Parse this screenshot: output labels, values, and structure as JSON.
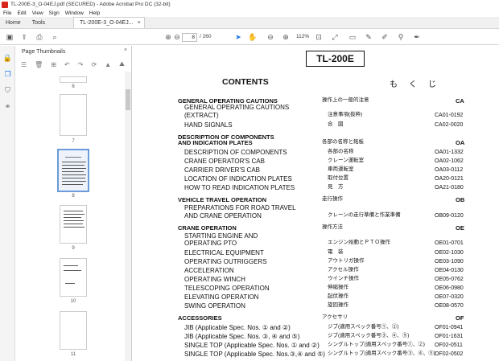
{
  "window": {
    "title": "TL-200E-3_O-04EJ.pdf (SECURED) - Adobe Acrobat Pro DC (32-bit)"
  },
  "menu": [
    "File",
    "Edit",
    "View",
    "Sign",
    "Window",
    "Help"
  ],
  "tabs": {
    "home": "Home",
    "tools": "Tools",
    "doc": "TL-200E-3_O-04EJ...",
    "close": "×"
  },
  "toolbar": {
    "page_current": "8",
    "page_total": "/ 260",
    "zoom": "112%"
  },
  "thumbnails": {
    "title": "Page Thumbnails",
    "close": "×",
    "pages": [
      "6",
      "7",
      "8",
      "9",
      "10",
      "11"
    ]
  },
  "doc": {
    "model": "TL-200E",
    "heading": "CONTENTS",
    "heading_jp": "もくじ",
    "entries": [
      {
        "en": "GENERAL OPERATING CAUTIONS",
        "jp": "操作上の一般的注意",
        "code": "CA",
        "type": "sec"
      },
      {
        "en": "GENERAL OPERATING CAUTIONS",
        "jp": "",
        "code": "",
        "type": "sub1"
      },
      {
        "en": "(EXTRACT)",
        "jp": "注意事項(抜粋)",
        "code": "CA01-0192",
        "type": "sub"
      },
      {
        "en": "HAND SIGNALS",
        "jp": "合　図",
        "code": "CA02-0020",
        "type": "sub"
      },
      {
        "en": "DESCRIPTION OF COMPONENTS",
        "jp": "",
        "code": "",
        "type": "sec1"
      },
      {
        "en": "AND INDICATION PLATES",
        "jp": "各部の名称と銘板",
        "code": "OA",
        "type": "sec"
      },
      {
        "en": "DESCRIPTION OF COMPONENTS",
        "jp": "各部の名称",
        "code": "OA01-1332",
        "type": "sub"
      },
      {
        "en": "CRANE OPERATOR'S CAB",
        "jp": "クレーン運転室",
        "code": "OA02-1062",
        "type": "sub"
      },
      {
        "en": "CARRIER DRIVER'S CAB",
        "jp": "車両運転室",
        "code": "OA03-0112",
        "type": "sub"
      },
      {
        "en": "LOCATION OF INDICATION PLATES",
        "jp": "取付位置",
        "code": "OA20-0121",
        "type": "sub"
      },
      {
        "en": "HOW TO READ INDICATION PLATES",
        "jp": "見　方",
        "code": "OA21-0180",
        "type": "sub"
      },
      {
        "en": "VEHICLE TRAVEL OPERATION",
        "jp": "走行操作",
        "code": "OB",
        "type": "sec"
      },
      {
        "en": "PREPARATIONS FOR ROAD TRAVEL",
        "jp": "",
        "code": "",
        "type": "sub1"
      },
      {
        "en": "AND CRANE OPERATION",
        "jp": "クレーンの走行準備と作業準備",
        "code": "OB09-0120",
        "type": "sub"
      },
      {
        "en": "CRANE OPERATION",
        "jp": "操作方法",
        "code": "OE",
        "type": "sec"
      },
      {
        "en": "STARTING ENGINE AND",
        "jp": "",
        "code": "",
        "type": "sub1"
      },
      {
        "en": "OPERATING PTO",
        "jp": "エンジン始動とＰＴＯ操作",
        "code": "OE01-0701",
        "type": "sub"
      },
      {
        "en": "ELECTRICAL EQUIPMENT",
        "jp": "電　装",
        "code": "OE02-1030",
        "type": "sub"
      },
      {
        "en": "OPERATING OUTRIGGERS",
        "jp": "アウトリガ操作",
        "code": "OE03-1090",
        "type": "sub"
      },
      {
        "en": "ACCELERATION",
        "jp": "アクセル操作",
        "code": "OE04-0130",
        "type": "sub"
      },
      {
        "en": "OPERATING WINCH",
        "jp": "ウインチ操作",
        "code": "OE05-0762",
        "type": "sub"
      },
      {
        "en": "TELESCOPING OPERATION",
        "jp": "伸縮操作",
        "code": "OE06-0980",
        "type": "sub"
      },
      {
        "en": "ELEVATING OPERATION",
        "jp": "起伏操作",
        "code": "OE07-0320",
        "type": "sub"
      },
      {
        "en": "SWING OPERATION",
        "jp": "旋回操作",
        "code": "OE08-0570",
        "type": "sub"
      },
      {
        "en": "ACCESSORIES",
        "jp": "アクセサリ",
        "code": "OF",
        "type": "sec"
      },
      {
        "en": "JIB (Applicable Spec. Nos. ① and ②)",
        "jp": "ジブ(適用スペック番号①、②)",
        "code": "OF01-0941",
        "type": "sub"
      },
      {
        "en": "JIB (Applicable Spec. Nos. ③, ④ and ⑤)",
        "jp": "ジブ(適用スペック番号③、④、⑤)",
        "code": "OF01-1631",
        "type": "sub"
      },
      {
        "en": "SINGLE TOP (Applicable Spec. Nos. ① and ②)",
        "jp": "シングルトップ(適用スペック番号①、②)",
        "code": "OF02-0511",
        "type": "sub"
      },
      {
        "en": "SINGLE TOP (Applicable Spec. Nos.③,④ and ⑤)",
        "jp": "シングルトップ(適用スペック番号③、④、⑤)",
        "code": "OF02-0502",
        "type": "sub"
      }
    ]
  }
}
